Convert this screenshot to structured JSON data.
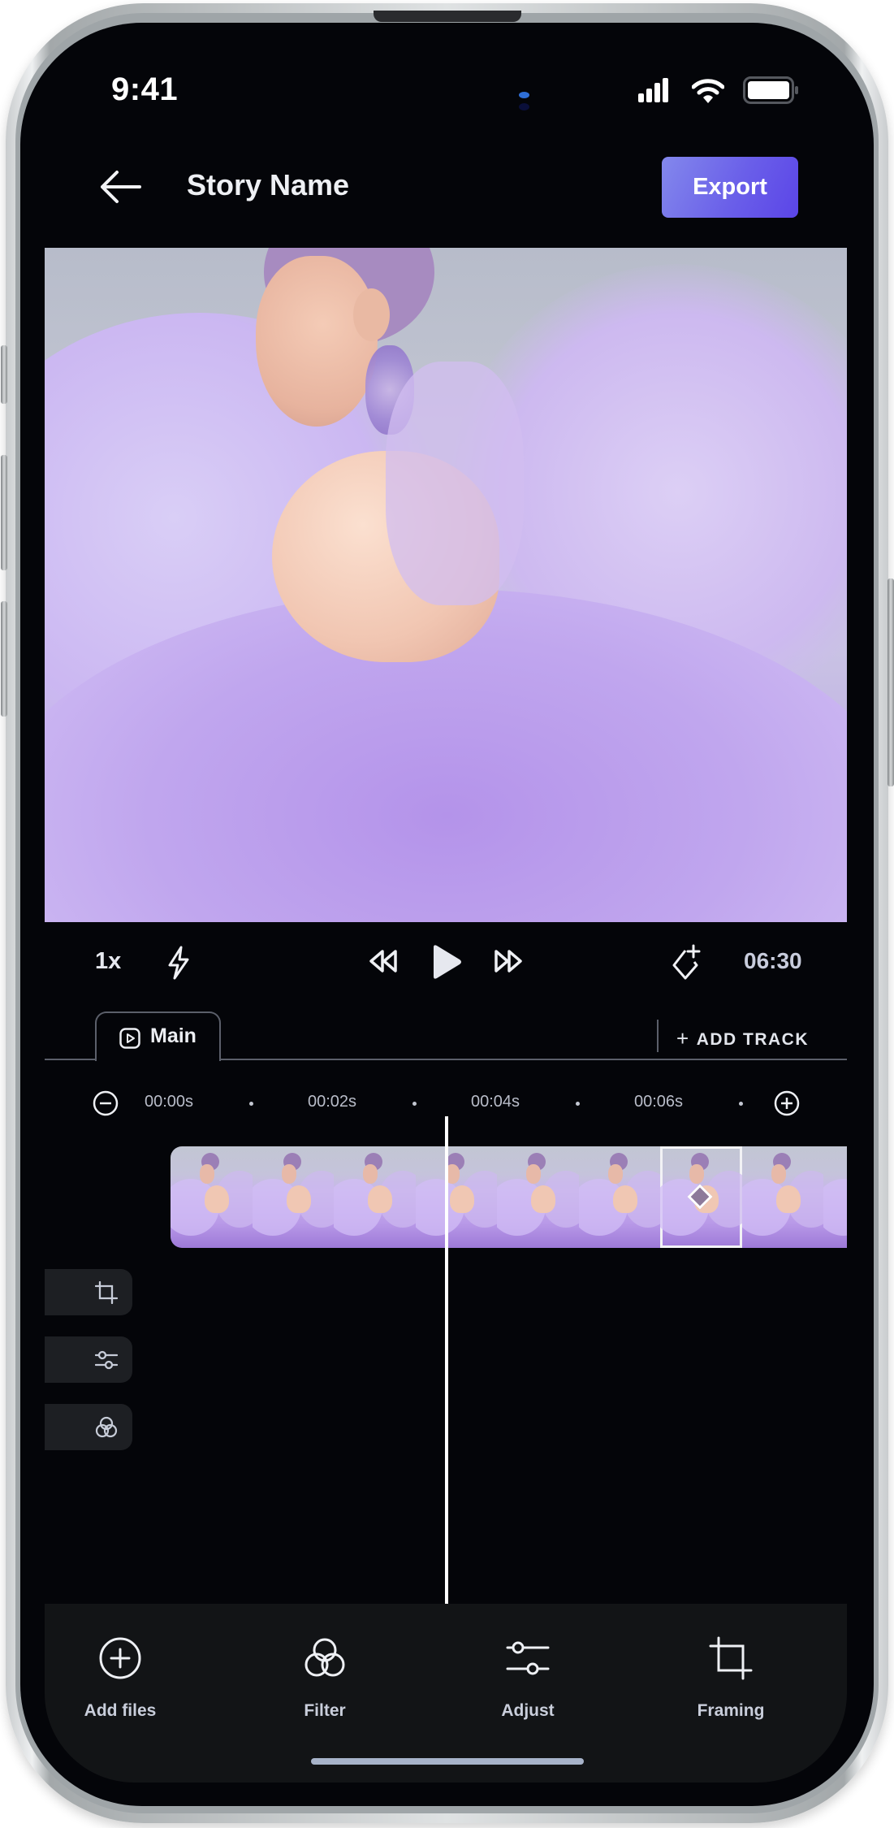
{
  "status_bar": {
    "time": "9:41",
    "icons": [
      "signal-icon",
      "wifi-icon",
      "battery-icon"
    ]
  },
  "header": {
    "back_icon": "arrow-left-icon",
    "title": "Story Name",
    "export_label": "Export"
  },
  "colors": {
    "accent_gradient_start": "#8388ec",
    "accent_gradient_end": "#5b45e8",
    "background": "#040509",
    "toolbar_bg": "#121416",
    "side_button_bg": "#1d1f23"
  },
  "preview": {
    "description": "Woman in lavender tulle gown, eyes closed, purple hair"
  },
  "playback": {
    "speed": "1x",
    "flash_icon": "lightning-icon",
    "rewind_icon": "rewind-icon",
    "play_icon": "play-icon",
    "forward_icon": "fast-forward-icon",
    "keyframe_icon": "add-keyframe-icon",
    "time": "06:30"
  },
  "tracks": {
    "tabs": [
      {
        "label": "Main",
        "icon": "video-play-icon",
        "active": true
      }
    ],
    "add_track_label": "ADD TRACK"
  },
  "ruler": {
    "zoom_out_icon": "minus-circle-icon",
    "zoom_in_icon": "plus-circle-icon",
    "labels": [
      "00:00s",
      "00:02s",
      "00:04s",
      "00:06s"
    ]
  },
  "timeline": {
    "frame_count": 9,
    "selected_frame_index": 6,
    "keyframe_on_frame": 6,
    "side_buttons": [
      {
        "icon": "crop-icon",
        "label": "Framing"
      },
      {
        "icon": "sliders-icon",
        "label": "Adjust"
      },
      {
        "icon": "filter-icon",
        "label": "Filter"
      }
    ]
  },
  "toolbar": {
    "items": [
      {
        "label": "Add files",
        "icon": "add-circle-icon"
      },
      {
        "label": "Filter",
        "icon": "filter-icon"
      },
      {
        "label": "Adjust",
        "icon": "sliders-icon"
      },
      {
        "label": "Framing",
        "icon": "crop-icon"
      }
    ]
  }
}
